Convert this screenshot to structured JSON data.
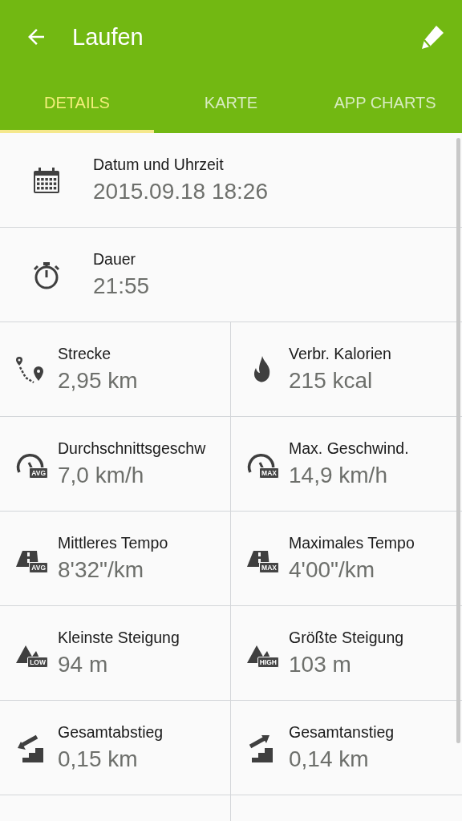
{
  "app_bar": {
    "title": "Laufen"
  },
  "tabs": [
    {
      "label": "DETAILS",
      "selected": true
    },
    {
      "label": "KARTE",
      "selected": false
    },
    {
      "label": "APP CHARTS",
      "selected": false
    }
  ],
  "full_rows": [
    {
      "kind": "calendar",
      "label": "Datum und Uhrzeit",
      "value": "2015.09.18 18:26"
    },
    {
      "kind": "stopwatch",
      "label": "Dauer",
      "value": "21:55"
    }
  ],
  "grid_cells": [
    {
      "kind": "route",
      "label": "Strecke",
      "value": "2,95 km"
    },
    {
      "kind": "flame",
      "label": "Verbr. Kalorien",
      "value": "215 kcal"
    },
    {
      "kind": "gauge",
      "badge": "AVG",
      "label": "Durchschnittsgeschw",
      "value": "7,0 km/h"
    },
    {
      "kind": "gauge",
      "badge": "MAX",
      "label": "Max. Geschwind.",
      "value": "14,9 km/h"
    },
    {
      "kind": "tempo",
      "badge": "AVG",
      "label": "Mittleres Tempo",
      "value": "8'32\"/km"
    },
    {
      "kind": "tempo",
      "badge": "MAX",
      "label": "Maximales Tempo",
      "value": "4'00\"/km"
    },
    {
      "kind": "mountain",
      "badge": "LOW",
      "label": "Kleinste Steigung",
      "value": "94 m"
    },
    {
      "kind": "mountain",
      "badge": "HIGH",
      "label": "Größte Steigung",
      "value": "103 m"
    },
    {
      "kind": "descent",
      "label": "Gesamtabstieg",
      "value": "0,15 km"
    },
    {
      "kind": "ascent",
      "label": "Gesamtanstieg",
      "value": "0,14 km"
    }
  ]
}
